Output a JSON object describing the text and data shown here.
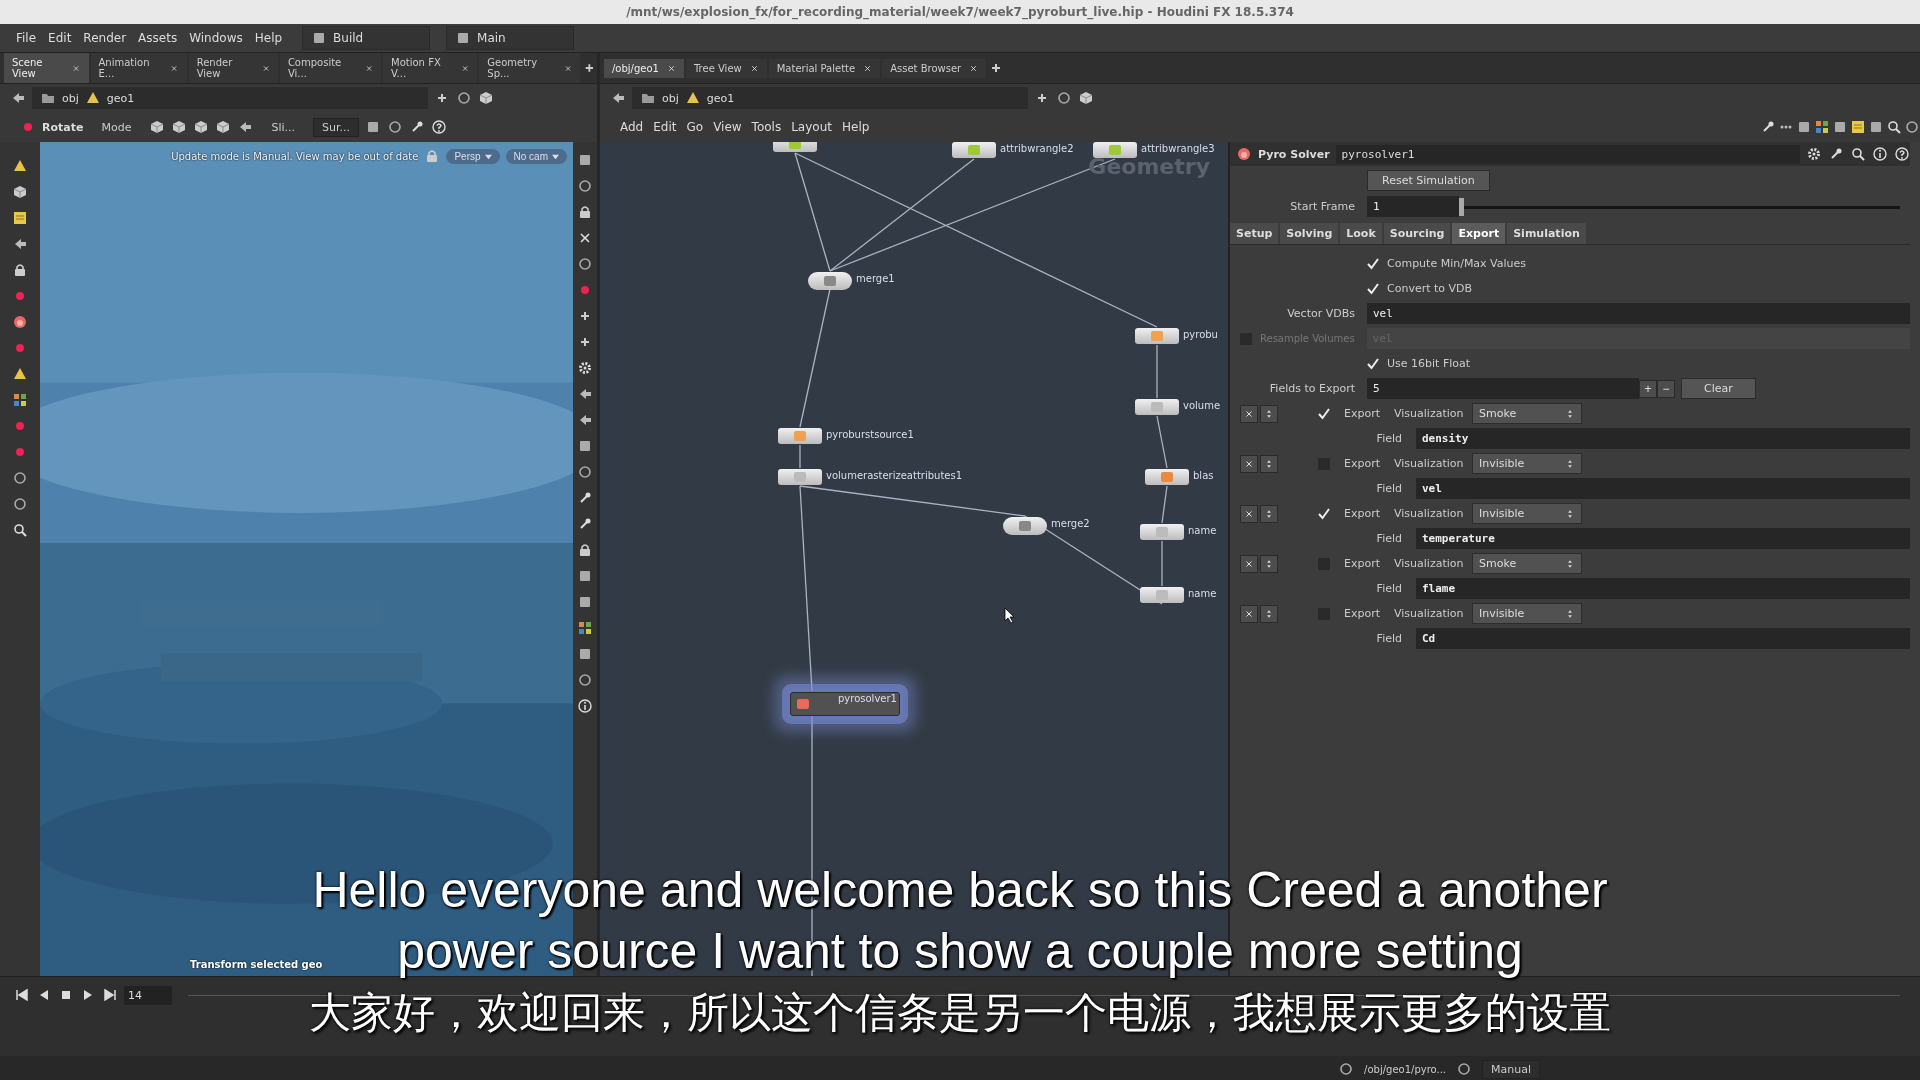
{
  "window": {
    "title": "/mnt/ws/explosion_fx/for_recording_material/week7/week7_pyroburt_live.hip - Houdini FX 18.5.374"
  },
  "menu": [
    "File",
    "Edit",
    "Render",
    "Assets",
    "Windows",
    "Help"
  ],
  "desktop_selectors": [
    {
      "label": "Build"
    },
    {
      "label": "Main"
    }
  ],
  "left_pane": {
    "tabs": [
      {
        "label": "Scene View",
        "selected": true
      },
      {
        "label": "Animation E...",
        "selected": false
      },
      {
        "label": "Render View",
        "selected": false
      },
      {
        "label": "Composite Vi...",
        "selected": false
      },
      {
        "label": "Motion FX V...",
        "selected": false
      },
      {
        "label": "Geometry Sp...",
        "selected": false
      }
    ],
    "path": [
      "obj",
      "geo1"
    ],
    "toolbar": {
      "tool": "Rotate",
      "mode": "Mode",
      "selection": "Sli...",
      "snap": "Sur..."
    },
    "viewport": {
      "notice": "Update mode is Manual. View may be out of date",
      "view_menu": "Persp",
      "camera_menu": "No cam",
      "status": "Transform selected geo"
    }
  },
  "right_pane": {
    "tabs": [
      {
        "label": "/obj/geo1",
        "selected": true
      },
      {
        "label": "Tree View",
        "selected": false
      },
      {
        "label": "Material Palette",
        "selected": false
      },
      {
        "label": "Asset Browser",
        "selected": false
      }
    ],
    "path": [
      "obj",
      "geo1"
    ],
    "menu": [
      "Add",
      "Edit",
      "Go",
      "View",
      "Tools",
      "Layout",
      "Help"
    ],
    "network": {
      "context": "Geometry",
      "nodes": [
        {
          "kind": "wrangle",
          "selected": false
        },
        {
          "name": "attribwrangle2",
          "kind": "wrangle",
          "selected": false
        },
        {
          "name": "attribwrangle3",
          "kind": "wrangle",
          "selected": false
        },
        {
          "name": "merge1",
          "kind": "merge",
          "selected": false
        },
        {
          "name": "pyrobu",
          "kind": "source",
          "selected": false
        },
        {
          "name": "volume",
          "kind": "plain",
          "selected": false
        },
        {
          "name": "pyroburstsource1",
          "kind": "source",
          "selected": false
        },
        {
          "name": "volumerasterizeattributes1",
          "kind": "plain",
          "selected": false
        },
        {
          "name": "blas",
          "kind": "blast",
          "selected": false
        },
        {
          "name": "merge2",
          "kind": "merge",
          "selected": false
        },
        {
          "name": "name",
          "kind": "plain",
          "selected": false
        },
        {
          "name": "name",
          "kind": "plain",
          "selected": false
        },
        {
          "name": "pyrosolver1",
          "kind": "solver",
          "selected": true
        }
      ]
    },
    "parameters": {
      "node_type": "Pyro Solver",
      "node_name": "pyrosolver1",
      "reset_button": "Reset Simulation",
      "start_frame": {
        "label": "Start Frame",
        "value": "1",
        "level": 0.0
      },
      "tabs": [
        {
          "label": "Setup",
          "selected": false
        },
        {
          "label": "Solving",
          "selected": false
        },
        {
          "label": "Look",
          "selected": false
        },
        {
          "label": "Sourcing",
          "selected": false
        },
        {
          "label": "Export",
          "selected": true
        },
        {
          "label": "Simulation",
          "selected": false
        }
      ],
      "rows": [
        {
          "kind": "checkbox",
          "label": "Compute Min/Max Values",
          "checked": true,
          "disabled": false
        },
        {
          "kind": "checkbox",
          "label": "Convert to VDB",
          "checked": true,
          "disabled": false
        },
        {
          "kind": "field",
          "label": "Vector VDBs",
          "value": "vel",
          "disabled": false
        },
        {
          "kind": "toggle_field",
          "label": "Resample Volumes",
          "value": "vel",
          "checked": false,
          "disabled": true
        },
        {
          "kind": "checkbox",
          "label": "Use 16bit Float",
          "checked": true,
          "disabled": false
        },
        {
          "kind": "multi_count",
          "label": "Fields to Export",
          "value": "5",
          "add": "+",
          "remove": "−",
          "clear": "Clear",
          "disabled": false
        }
      ],
      "fields": [
        {
          "export_label": "Export",
          "checked": true,
          "visualization_label": "Visualization",
          "visualization": "Smoke",
          "field_label": "Field",
          "field": "density"
        },
        {
          "export_label": "Export",
          "checked": false,
          "visualization_label": "Visualization",
          "visualization": "Invisible",
          "field_label": "Field",
          "field": "vel"
        },
        {
          "export_label": "Export",
          "checked": true,
          "visualization_label": "Visualization",
          "visualization": "Invisible",
          "field_label": "Field",
          "field": "temperature"
        },
        {
          "export_label": "Export",
          "checked": false,
          "visualization_label": "Visualization",
          "visualization": "Smoke",
          "field_label": "Field",
          "field": "flame"
        },
        {
          "export_label": "Export",
          "checked": false,
          "visualization_label": "Visualization",
          "visualization": "Invisible",
          "field_label": "Field",
          "field": "Cd"
        }
      ]
    }
  },
  "playbar": {
    "frame": "14"
  },
  "status_bar": {
    "path": "/obj/geo1/pyro...",
    "update_mode": "Manual"
  },
  "subtitles": {
    "english": [
      "Hello everyone and welcome back so this Creed a another",
      "power source I want to show a couple more setting"
    ],
    "chinese": "大家好，欢迎回来，所以这个信条是另一个电源，我想展示更多的设置"
  }
}
